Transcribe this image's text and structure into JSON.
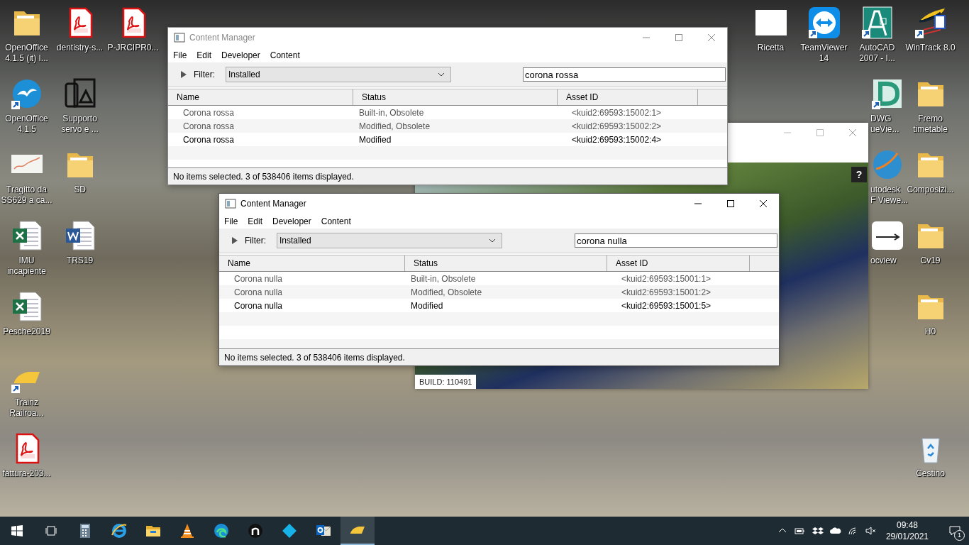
{
  "desktop": {
    "left_columns": [
      [
        {
          "kind": "folder",
          "label": [
            "OpenOffice",
            "4.1.5 (it) I..."
          ],
          "shortcut": false
        },
        {
          "kind": "openoffice",
          "label": [
            "OpenOffice",
            "4.1.5"
          ],
          "shortcut": true
        },
        {
          "kind": "map",
          "label": [
            "Tragitto da",
            "SS629 a ca..."
          ],
          "shortcut": false
        },
        {
          "kind": "excel",
          "label": [
            "IMU",
            "incapiente"
          ],
          "shortcut": false
        },
        {
          "kind": "excel",
          "label": [
            "Pesche2019"
          ],
          "shortcut": false
        },
        {
          "kind": "trainz",
          "label": [
            "Trainz",
            "Railroa..."
          ],
          "shortcut": true
        },
        {
          "kind": "pdf",
          "label": [
            "fattura-203..."
          ],
          "shortcut": false
        }
      ],
      [
        {
          "kind": "pdf",
          "label": [
            "dentistry-s..."
          ],
          "shortcut": false
        },
        {
          "kind": "app",
          "label": [
            "Supporto",
            "servo e ..."
          ],
          "shortcut": false
        },
        {
          "kind": "folder",
          "label": [
            "SD"
          ],
          "shortcut": false
        },
        {
          "kind": "word",
          "label": [
            "TRS19"
          ],
          "shortcut": false
        }
      ],
      [
        {
          "kind": "pdf",
          "label": [
            "P-JRCIPR0..."
          ],
          "shortcut": false
        }
      ]
    ],
    "right_columns": [
      [
        {
          "kind": "blank",
          "label": [
            "Ricetta"
          ],
          "shortcut": false
        }
      ],
      [
        {
          "kind": "teamviewer",
          "label": [
            "TeamViewer",
            "14"
          ],
          "shortcut": true
        }
      ],
      [
        {
          "kind": "autocad",
          "label": [
            "AutoCAD",
            "2007 - I..."
          ],
          "shortcut": true
        },
        {
          "kind": "dwg",
          "label": [
            "DWG",
            "ueVie..."
          ],
          "shortcut": true
        },
        {
          "kind": "globe",
          "label": [
            "utodesk",
            "F Viewe..."
          ],
          "shortcut": false
        },
        {
          "kind": "rocview",
          "label": [
            "ocview"
          ],
          "shortcut": false
        }
      ],
      [
        {
          "kind": "wintrack",
          "label": [
            "WinTrack 8.0"
          ],
          "shortcut": true
        },
        {
          "kind": "folder",
          "label": [
            "Fremo",
            "timetable"
          ],
          "shortcut": false
        },
        {
          "kind": "folder",
          "label": [
            "Composizi..."
          ],
          "shortcut": false
        },
        {
          "kind": "folder",
          "label": [
            "Cv19"
          ],
          "shortcut": false
        },
        {
          "kind": "folder",
          "label": [
            "H0"
          ],
          "shortcut": false
        }
      ]
    ],
    "recycle_bin": {
      "label": [
        "Cestino"
      ]
    }
  },
  "splash": {
    "help_button": "?",
    "build": "BUILD: 110491"
  },
  "windows": [
    {
      "title": "Content Manager",
      "active": false,
      "menu": [
        "File",
        "Edit",
        "Developer",
        "Content"
      ],
      "filter_label": "Filter:",
      "filter_value": "Installed",
      "search_value": "corona rossa",
      "columns": [
        "Name",
        "Status",
        "Asset ID"
      ],
      "rows": [
        {
          "name": "Corona rossa",
          "status": "Built-in, Obsolete",
          "asset_id": "<kuid2:69593:15002:1>",
          "greyed": true
        },
        {
          "name": "Corona rossa",
          "status": "Modified, Obsolete",
          "asset_id": "<kuid2:69593:15002:2>",
          "greyed": true
        },
        {
          "name": "Corona rossa",
          "status": "Modified",
          "asset_id": "<kuid2:69593:15002:4>",
          "greyed": false
        }
      ],
      "status_text": "No items selected. 3 of 538406 items displayed."
    },
    {
      "title": "Content Manager",
      "active": true,
      "menu": [
        "File",
        "Edit",
        "Developer",
        "Content"
      ],
      "filter_label": "Filter:",
      "filter_value": "Installed",
      "search_value": "corona nulla",
      "columns": [
        "Name",
        "Status",
        "Asset ID"
      ],
      "rows": [
        {
          "name": "Corona nulla",
          "status": "Built-in, Obsolete",
          "asset_id": "<kuid2:69593:15001:1>",
          "greyed": true
        },
        {
          "name": "Corona nulla",
          "status": "Modified, Obsolete",
          "asset_id": "<kuid2:69593:15001:2>",
          "greyed": true
        },
        {
          "name": "Corona nulla",
          "status": "Modified",
          "asset_id": "<kuid2:69593:15001:5>",
          "greyed": false
        }
      ],
      "status_text": "No items selected. 3 of 538406 items displayed."
    }
  ],
  "taskbar": {
    "apps": [
      {
        "kind": "calculator",
        "active": false
      },
      {
        "kind": "ie",
        "active": false
      },
      {
        "kind": "explorer",
        "active": false
      },
      {
        "kind": "vlc",
        "active": false
      },
      {
        "kind": "edge",
        "active": false
      },
      {
        "kind": "n-app",
        "active": false
      },
      {
        "kind": "kodi",
        "active": false
      },
      {
        "kind": "outlook",
        "active": false
      },
      {
        "kind": "trainz",
        "active": true
      }
    ],
    "time": "09:48",
    "date": "29/01/2021",
    "notifications": "1"
  }
}
